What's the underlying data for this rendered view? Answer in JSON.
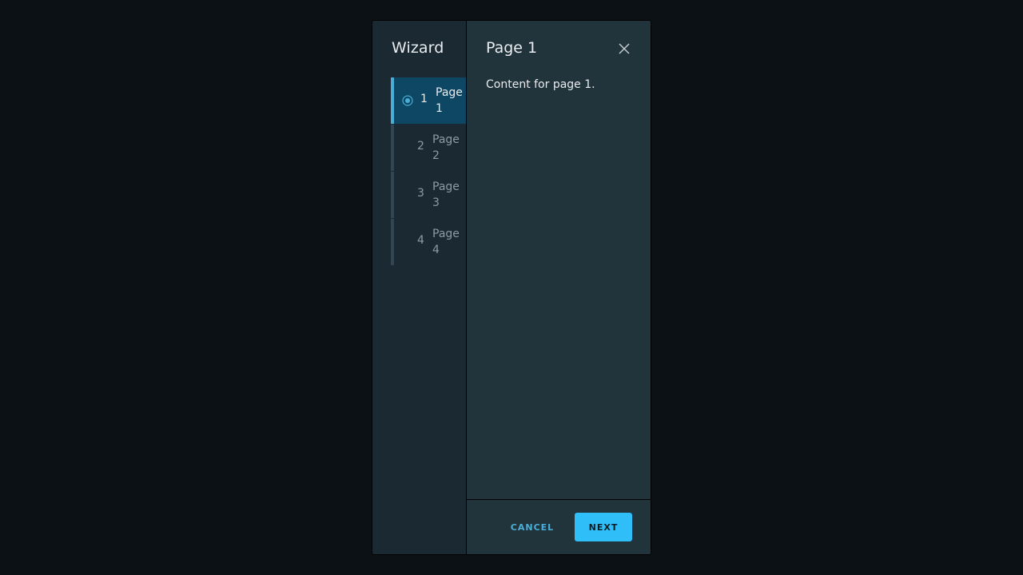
{
  "wizard": {
    "title": "Wizard",
    "steps": [
      {
        "number": "1",
        "label": "Page 1",
        "active": true
      },
      {
        "number": "2",
        "label": "Page 2",
        "active": false
      },
      {
        "number": "3",
        "label": "Page 3",
        "active": false
      },
      {
        "number": "4",
        "label": "Page 4",
        "active": false
      }
    ]
  },
  "page": {
    "title": "Page 1",
    "content": "Content for page 1."
  },
  "footer": {
    "cancel_label": "CANCEL",
    "next_label": "NEXT"
  },
  "icons": {
    "close": "close-icon",
    "current_step": "radio-dot-icon"
  },
  "colors": {
    "accent": "#49afd9",
    "primary_button": "#2fbef7",
    "active_step_bg": "#0e4763"
  }
}
